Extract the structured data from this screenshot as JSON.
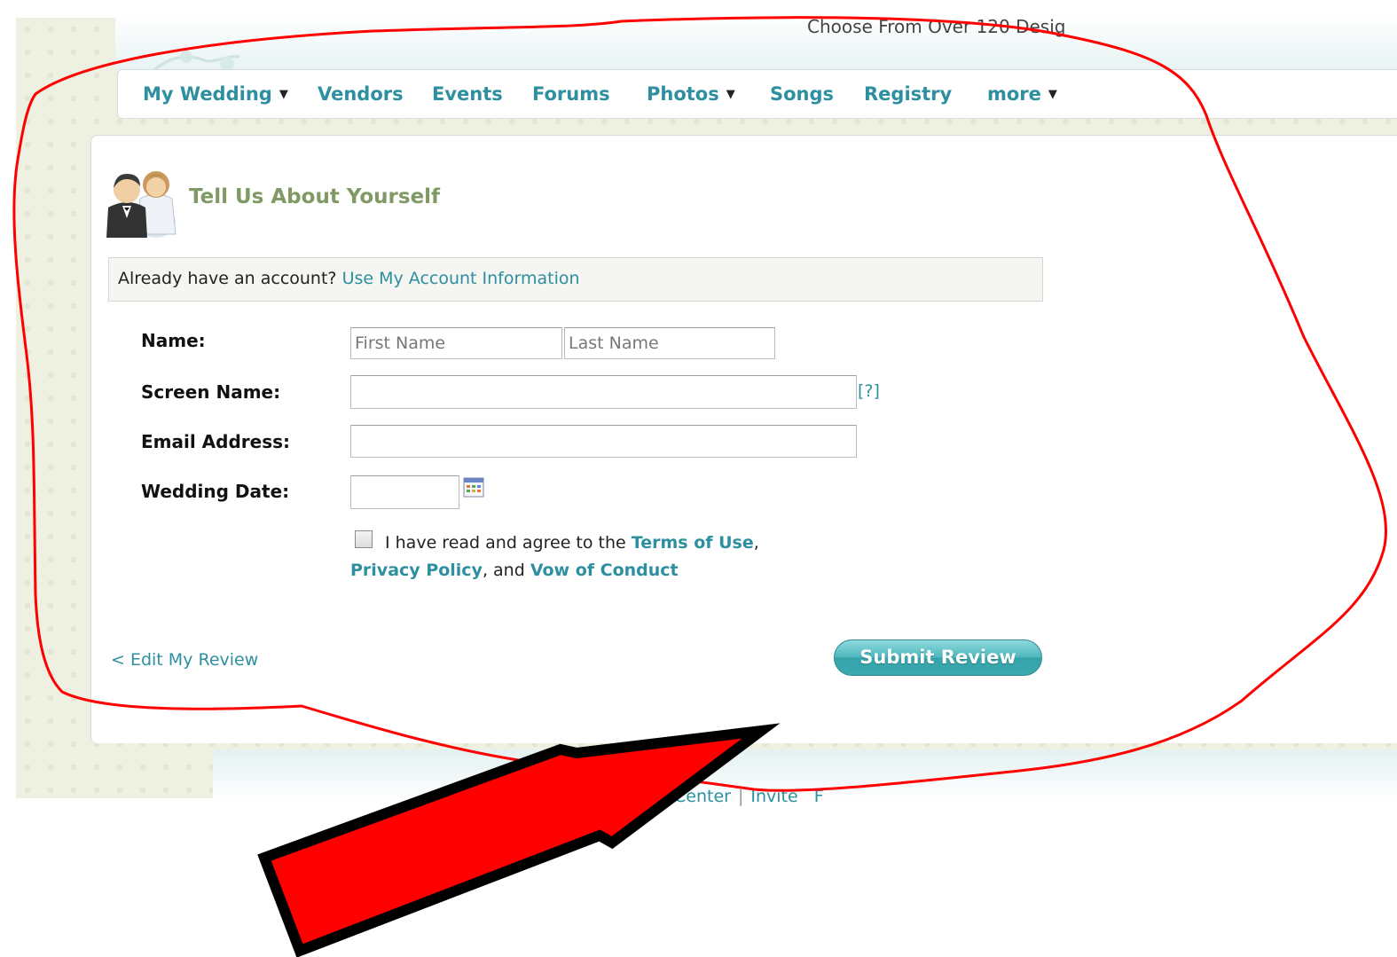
{
  "header": {
    "promo_text": "Choose From Over 120 Desig"
  },
  "nav": {
    "items": [
      {
        "label": "My Wedding",
        "caret": "▼"
      },
      {
        "label": "Vendors"
      },
      {
        "label": "Events"
      },
      {
        "label": "Forums"
      },
      {
        "label": "Photos",
        "caret": "▼"
      },
      {
        "label": "Songs"
      },
      {
        "label": "Registry"
      },
      {
        "label": "more",
        "caret": "▼"
      }
    ]
  },
  "form": {
    "heading": "Tell Us About Yourself",
    "icon": "bride-groom-icon",
    "account_prompt": "Already have an account?",
    "account_link": "Use My Account Information",
    "name_label": "Name:",
    "first_name_placeholder": "First Name",
    "last_name_placeholder": "Last Name",
    "screen_name_label": "Screen Name:",
    "screen_name_help": "[?]",
    "email_label": "Email Address:",
    "wedding_date_label": "Wedding Date:",
    "calendar_icon": "calendar-icon",
    "agree_text": "I have read and agree to the",
    "terms_link": "Terms of Use",
    "comma": ",",
    "privacy_link": "Privacy Policy",
    "and_text": ", and",
    "vow_link": "Vow of Conduct",
    "checkbox_checked": false
  },
  "actions": {
    "edit_link": "< Edit My Review",
    "submit_label": "Submit Review"
  },
  "footer": {
    "link_1": "Center",
    "link_2": "Invite",
    "link_3": "F"
  },
  "colors": {
    "link": "#2d8fa0",
    "heading": "#7f9a64",
    "annotation_red": "#ff0000",
    "annotation_outline": "#000000",
    "button": "#3aa9b0"
  }
}
